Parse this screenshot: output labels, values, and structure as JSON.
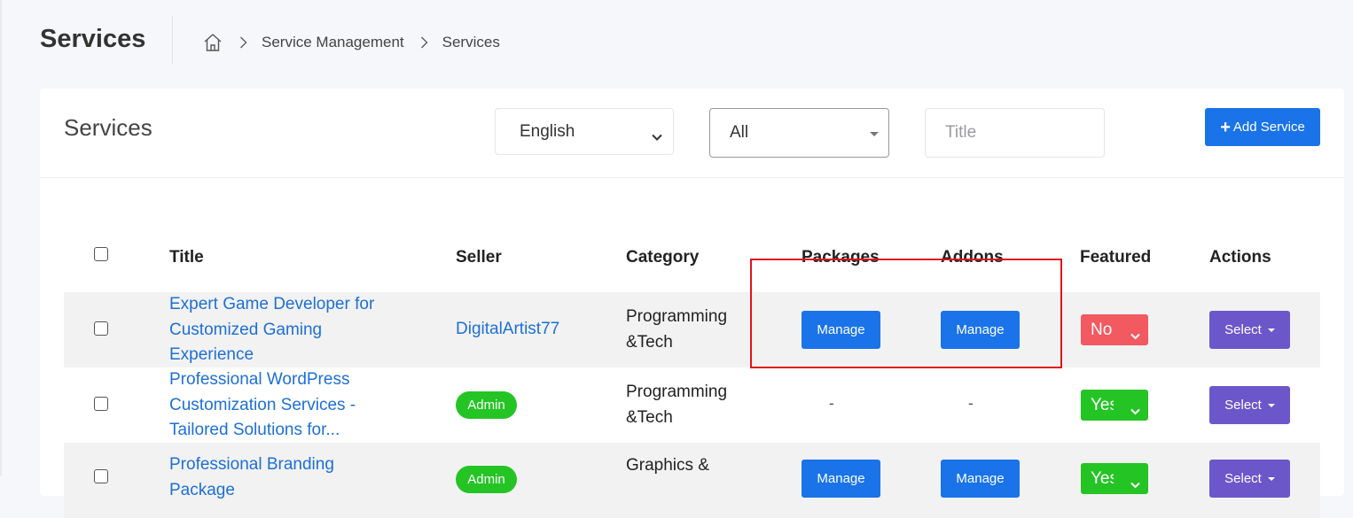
{
  "header": {
    "page_title": "Services",
    "breadcrumb": [
      "Service Management",
      "Services"
    ]
  },
  "card": {
    "title": "Services",
    "language_select": "English",
    "category_select": "All",
    "title_placeholder": "Title",
    "add_button_label": "Add Service"
  },
  "table": {
    "columns": [
      "Title",
      "Seller",
      "Category",
      "Packages",
      "Addons",
      "Featured",
      "Actions"
    ],
    "rows": [
      {
        "title_lines": [
          "Expert Game Developer for",
          "Customized Gaming",
          "Experience"
        ],
        "seller": "DigitalArtist77",
        "category_lines": [
          "Programming",
          "&Tech"
        ],
        "packages": "Manage",
        "addons": "Manage",
        "featured": "No",
        "actions": "Select"
      },
      {
        "title_lines": [
          "Professional WordPress",
          "Customization Services -",
          "Tailored Solutions for..."
        ],
        "seller": "Admin",
        "category_lines": [
          "Programming",
          "&Tech"
        ],
        "packages": "-",
        "addons": "-",
        "featured": "Yes",
        "actions": "Select"
      },
      {
        "title_lines": [
          "Professional Branding Package"
        ],
        "seller": "Admin",
        "category_lines": [
          "Graphics &"
        ],
        "packages": "Manage",
        "addons": "Manage",
        "featured": "Yes",
        "actions": "Select"
      }
    ]
  },
  "colors": {
    "primary": "#1a73e8",
    "success": "#25c425",
    "danger": "#f25961",
    "purple": "#6b57c9",
    "highlight": "#e0141c"
  },
  "icons": {
    "home": "home-icon",
    "separator": "chevron-right-icon"
  }
}
